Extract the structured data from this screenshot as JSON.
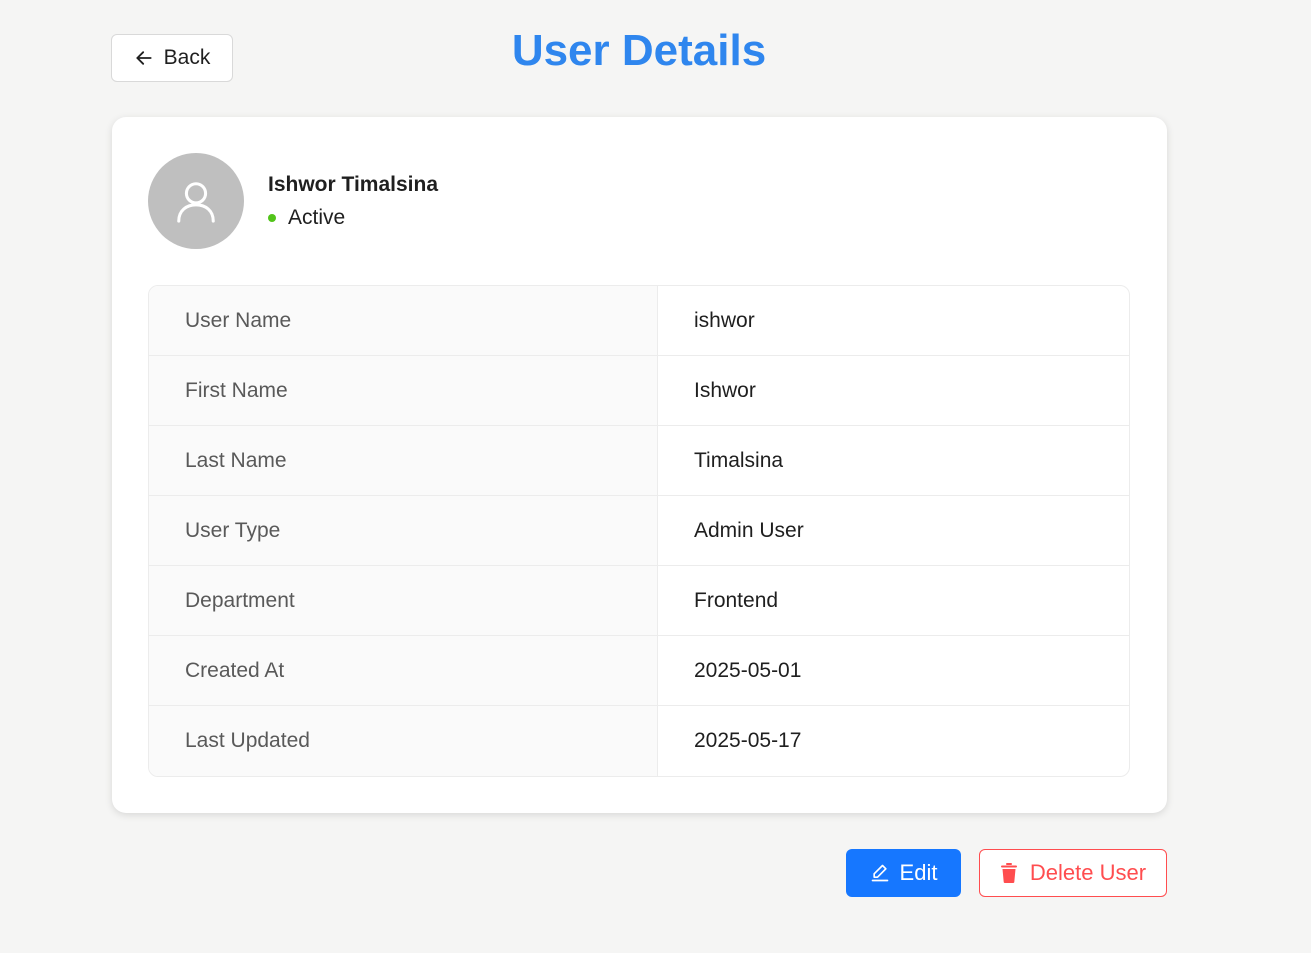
{
  "header": {
    "back_label": "Back",
    "title": "User Details"
  },
  "profile": {
    "full_name": "Ishwor Timalsina",
    "status": "Active",
    "status_color": "#52c41a",
    "avatar_icon": "user-icon"
  },
  "details": [
    {
      "label": "User Name",
      "value": "ishwor"
    },
    {
      "label": "First Name",
      "value": "Ishwor"
    },
    {
      "label": "Last Name",
      "value": "Timalsina"
    },
    {
      "label": "User Type",
      "value": "Admin User"
    },
    {
      "label": "Department",
      "value": "Frontend"
    },
    {
      "label": "Created At",
      "value": "2025-05-01"
    },
    {
      "label": "Last Updated",
      "value": "2025-05-17"
    }
  ],
  "actions": {
    "edit_label": "Edit",
    "delete_label": "Delete User"
  },
  "colors": {
    "accent": "#1677ff",
    "title": "#2f86ee",
    "danger": "#ff4d4f"
  }
}
